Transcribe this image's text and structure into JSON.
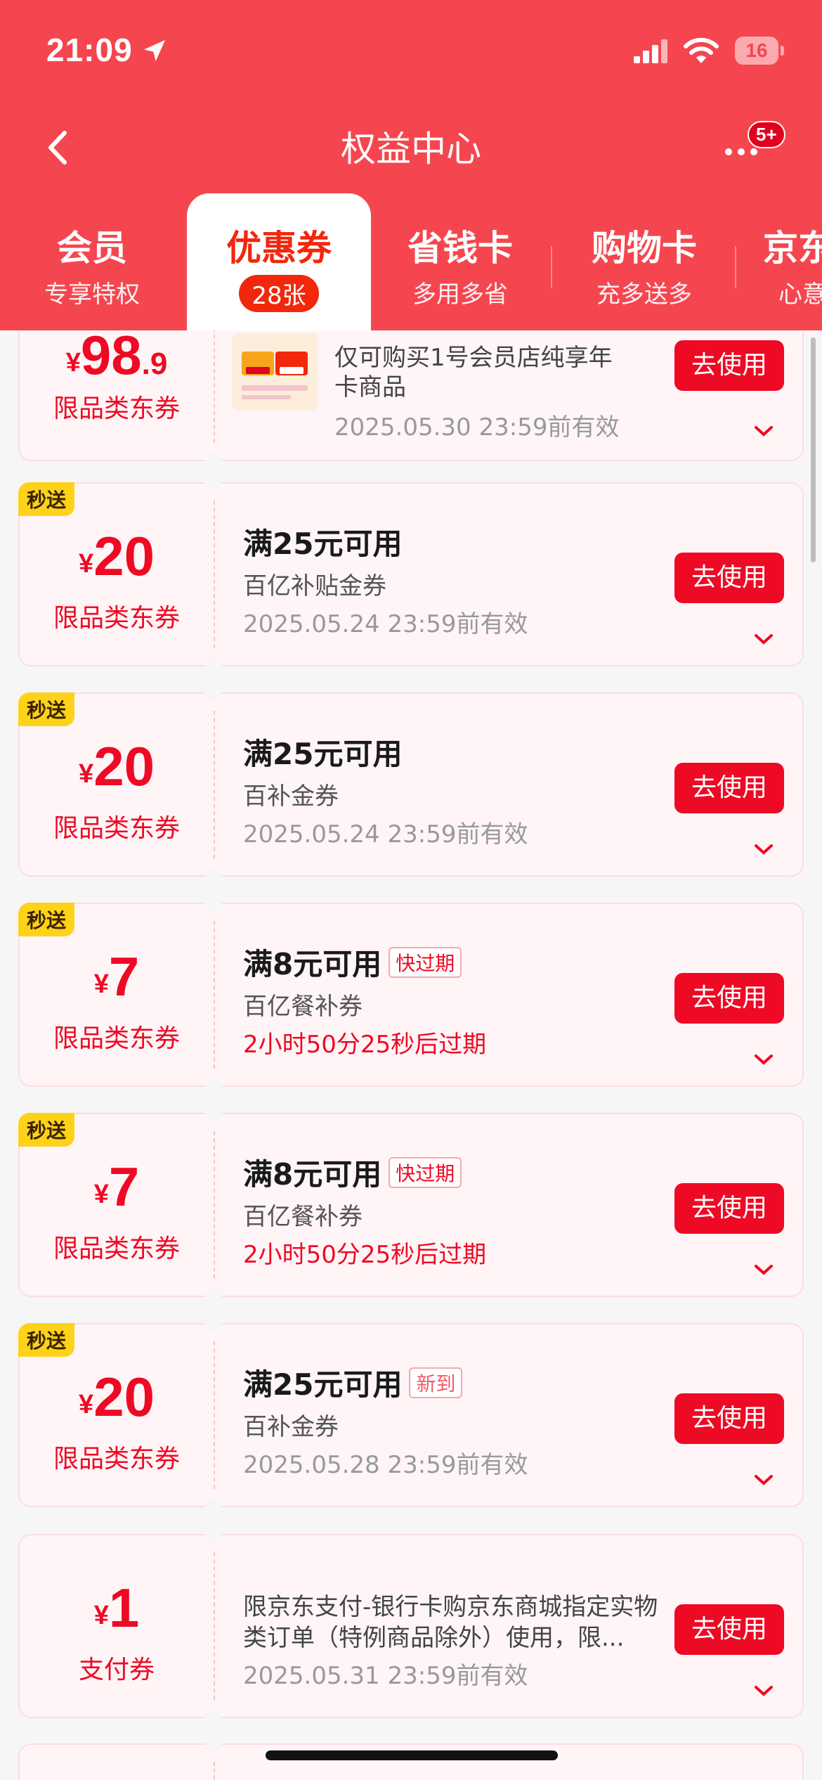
{
  "status_bar": {
    "time": "21:09",
    "battery": "16"
  },
  "nav": {
    "title": "权益中心",
    "more_badge": "5+"
  },
  "tabs": [
    {
      "title": "会员",
      "subtitle": "专享特权"
    },
    {
      "title": "优惠券",
      "count": "28张"
    },
    {
      "title": "省钱卡",
      "subtitle": "多用多省"
    },
    {
      "title": "购物卡",
      "subtitle": "充多送多"
    },
    {
      "title": "京东",
      "subtitle": "心意"
    }
  ],
  "coupons": [
    {
      "amount_int": "98",
      "amount_dec": ".9",
      "currency": "¥",
      "type": "限品类东券",
      "desc": "仅可购买1号会员店纯享年卡商品",
      "expiry": "2025.05.30 23:59前有效",
      "button": "去使用"
    },
    {
      "tag": "秒送",
      "amount_int": "20",
      "currency": "¥",
      "type": "限品类东券",
      "title": "满25元可用",
      "desc": "百亿补贴金券",
      "expiry": "2025.05.24 23:59前有效",
      "button": "去使用"
    },
    {
      "tag": "秒送",
      "amount_int": "20",
      "currency": "¥",
      "type": "限品类东券",
      "title": "满25元可用",
      "desc": "百补金券",
      "expiry": "2025.05.24 23:59前有效",
      "button": "去使用"
    },
    {
      "tag": "秒送",
      "amount_int": "7",
      "currency": "¥",
      "type": "限品类东券",
      "title": "满8元可用",
      "badge": "快过期",
      "desc": "百亿餐补券",
      "expiry": "2小时50分25秒后过期",
      "button": "去使用"
    },
    {
      "tag": "秒送",
      "amount_int": "7",
      "currency": "¥",
      "type": "限品类东券",
      "title": "满8元可用",
      "badge": "快过期",
      "desc": "百亿餐补券",
      "expiry": "2小时50分25秒后过期",
      "button": "去使用"
    },
    {
      "tag": "秒送",
      "amount_int": "20",
      "currency": "¥",
      "type": "限品类东券",
      "title": "满25元可用",
      "badge": "新到",
      "desc": "百补金券",
      "expiry": "2025.05.28 23:59前有效",
      "button": "去使用"
    },
    {
      "amount_int": "1",
      "currency": "¥",
      "type": "支付券",
      "desc": "限京东支付-银行卡购京东商城指定实物类订单（特例商品除外）使用，限...",
      "expiry": "2025.05.31 23:59前有效",
      "button": "去使用"
    }
  ],
  "colors": {
    "brand": "#f5464f",
    "accent": "#ee0a24",
    "tag": "#ffd21a"
  }
}
